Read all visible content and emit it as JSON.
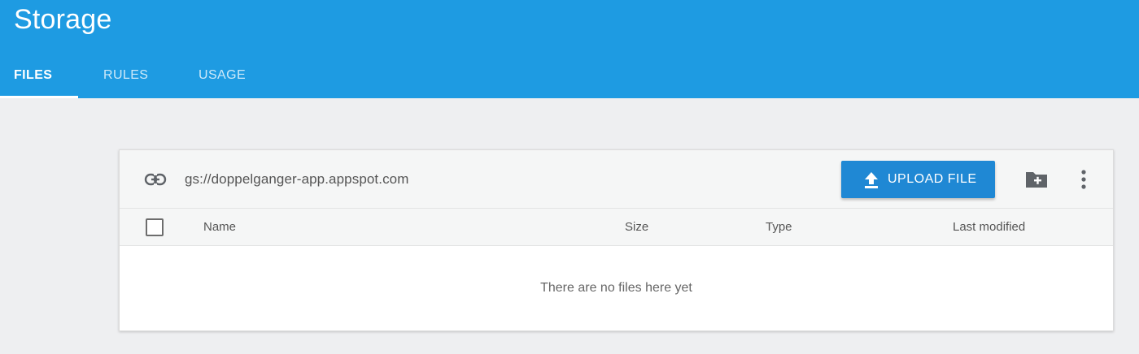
{
  "app": {
    "title": "Storage"
  },
  "tabs": [
    {
      "label": "FILES",
      "active": true
    },
    {
      "label": "RULES",
      "active": false
    },
    {
      "label": "USAGE",
      "active": false
    }
  ],
  "bucket": {
    "path": "gs://doppelganger-app.appspot.com",
    "upload_label": "UPLOAD FILE"
  },
  "table": {
    "columns": [
      "Name",
      "Size",
      "Type",
      "Last modified"
    ],
    "rows": [],
    "empty_message": "There are no files here yet"
  },
  "icons": {
    "bucket_link": "link-icon",
    "upload": "upload-icon",
    "new_folder": "new-folder-icon",
    "more": "more-vertical-icon"
  },
  "colors": {
    "appbar": "#1e9be2",
    "primary_button": "#1f88d4",
    "page_background": "#eeeff1"
  }
}
